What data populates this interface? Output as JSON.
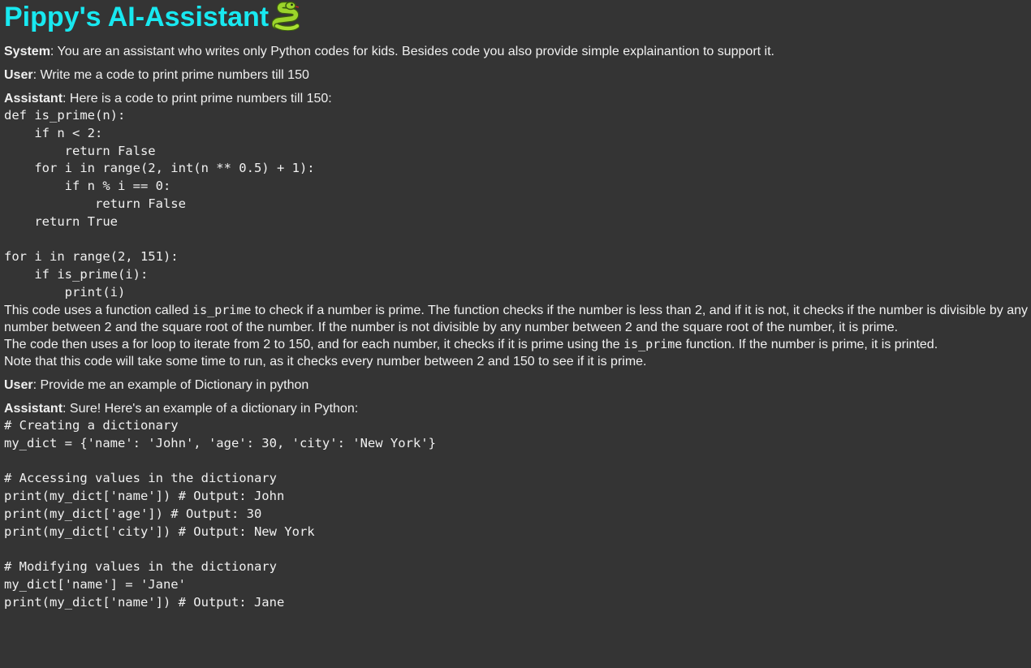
{
  "header": {
    "title": "Pippy's AI-Assistant",
    "icon": "snake-icon"
  },
  "colors": {
    "background": "#343434",
    "title": "#18e8f0",
    "text": "#f0f0f0"
  },
  "conversation": {
    "system": {
      "role": "System",
      "text": ": You are an assistant who writes only Python codes for kids. Besides code you also provide simple explainantion to support it."
    },
    "user1": {
      "role": "User",
      "text": ": Write me a code to print prime numbers till 150"
    },
    "assistant1": {
      "role": "Assistant",
      "text": ": Here is a code to print prime numbers till 150:",
      "code": "def is_prime(n):\n    if n < 2:\n        return False\n    for i in range(2, int(n ** 0.5) + 1):\n        if n % i == 0:\n            return False\n    return True\n\nfor i in range(2, 151):\n    if is_prime(i):\n        print(i)",
      "para1_pre": "This code uses a function called ",
      "para1_code": "is_prime",
      "para1_post": " to check if a number is prime. The function checks if the number is less than 2, and if it is not, it checks if the number is divisible by any number between 2 and the square root of the number. If the number is not divisible by any number between 2 and the square root of the number, it is prime.",
      "para2_pre": "The code then uses a for loop to iterate from 2 to 150, and for each number, it checks if it is prime using the ",
      "para2_code": "is_prime",
      "para2_post": " function. If the number is prime, it is printed.",
      "para3": "Note that this code will take some time to run, as it checks every number between 2 and 150 to see if it is prime."
    },
    "user2": {
      "role": "User",
      "text": ": Provide me an example of Dictionary in python"
    },
    "assistant2": {
      "role": "Assistant",
      "text": ": Sure! Here's an example of a dictionary in Python:",
      "code": "# Creating a dictionary\nmy_dict = {'name': 'John', 'age': 30, 'city': 'New York'}\n\n# Accessing values in the dictionary\nprint(my_dict['name']) # Output: John\nprint(my_dict['age']) # Output: 30\nprint(my_dict['city']) # Output: New York\n\n# Modifying values in the dictionary\nmy_dict['name'] = 'Jane'\nprint(my_dict['name']) # Output: Jane"
    }
  }
}
